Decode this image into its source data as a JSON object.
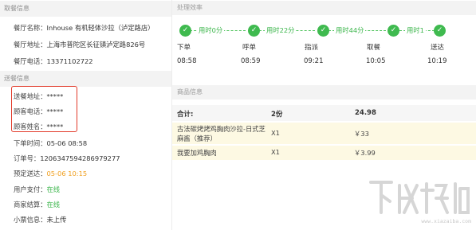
{
  "pickup": {
    "header": "取餐信息",
    "shop_name_label": "餐厅名称：",
    "shop_name": "Inhouse 有机轻体沙拉（泸定路店）",
    "shop_addr_label": "餐厅地址：",
    "shop_addr": "上海市普陀区长征镇泸定路826号",
    "shop_phone_label": "餐厅电话：",
    "shop_phone": "13371102722"
  },
  "delivery": {
    "header": "送餐信息",
    "addr_label": "送餐地址：",
    "addr": "*****",
    "phone_label": "顾客电话：",
    "phone": "*****",
    "name_label": "顾客姓名：",
    "name": "*****",
    "order_time_label": "下单时间：",
    "order_time": "05-06 08:58",
    "order_no_label": "订单号：",
    "order_no": "1206347594286979277",
    "eta_label": "预定送达：",
    "eta": "05-06 10:15",
    "user_pay_label": "用户支付：",
    "user_pay": "在线",
    "merchant_settle_label": "商家结算：",
    "merchant_settle": "在线",
    "receipt_label": "小票信息：",
    "receipt": "未上传"
  },
  "efficiency": {
    "header": "处理效率",
    "segments": [
      "用时0分",
      "用时22分",
      "用时44分",
      "用时1"
    ],
    "steps": [
      {
        "label": "下单",
        "time": "08:58"
      },
      {
        "label": "呼单",
        "time": "08:59"
      },
      {
        "label": "指派",
        "time": "09:21"
      },
      {
        "label": "取餐",
        "time": "10:05"
      },
      {
        "label": "送达",
        "time": "10:19"
      }
    ]
  },
  "goods": {
    "header": "商品信息",
    "total_label": "合计:",
    "total_qty": "2份",
    "total_price": "24.98",
    "items": [
      {
        "name_line1": "古法碳烤烤鸡胸肉沙拉-日式芝",
        "name_line2": "麻酱（推荐）",
        "qty": "X1",
        "price": "￥33"
      },
      {
        "name_line1": "我要加鸡胸肉",
        "name_line2": "",
        "qty": "X1",
        "price": "￥3.99"
      }
    ]
  },
  "watermark": {
    "text": "www.xiazaiba.com"
  },
  "colors": {
    "accent_green": "#3fba4f",
    "orange": "#f0a020",
    "highlight_red": "#e23a2a",
    "row_bg": "#fdf9e3"
  }
}
